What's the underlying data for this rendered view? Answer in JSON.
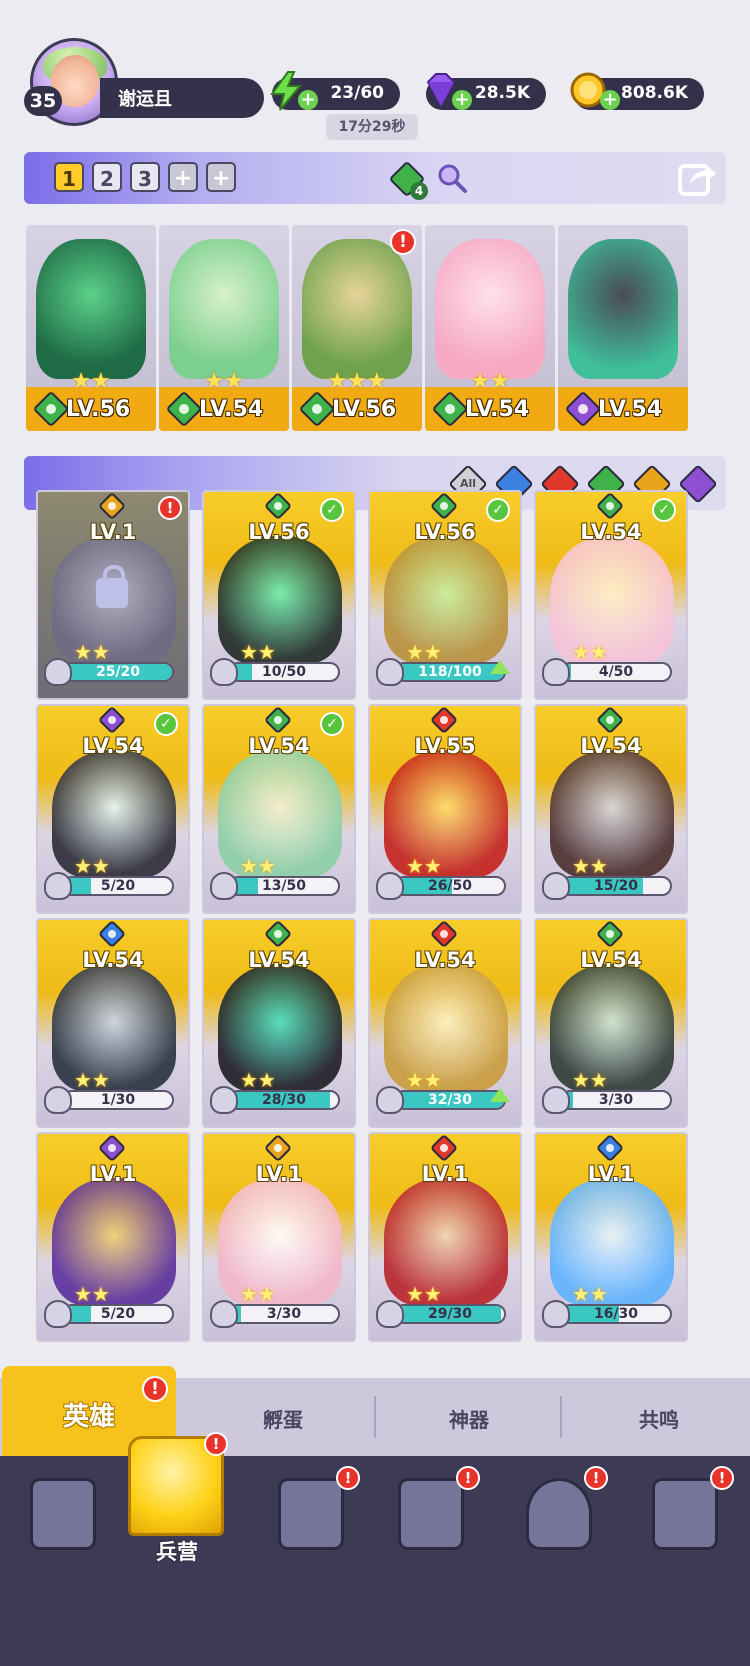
{
  "player": {
    "level": "35",
    "name": "谢运且"
  },
  "resources": {
    "energy": "23/60",
    "energy_timer": "17分29秒",
    "gems": "28.5K",
    "coins": "808.6K"
  },
  "formation": {
    "team_tabs": [
      "1",
      "2",
      "3",
      "+",
      "+"
    ],
    "active_team": "1",
    "artifact_count": "4",
    "cards": [
      {
        "stars": "★★",
        "level": "LV.56",
        "element": "nature",
        "alert": false
      },
      {
        "stars": "★★",
        "level": "LV.54",
        "element": "nature",
        "alert": false
      },
      {
        "stars": "★★★",
        "level": "LV.56",
        "element": "nature",
        "alert": true
      },
      {
        "stars": "★★",
        "level": "LV.54",
        "element": "nature",
        "alert": false
      },
      {
        "stars": "",
        "level": "LV.54",
        "element": "dark",
        "alert": false
      }
    ]
  },
  "filters": {
    "all_label": "All",
    "elements": [
      "water",
      "fire",
      "nature",
      "light",
      "dark"
    ]
  },
  "colors": {
    "nature": "#3fb34a",
    "dark": "#8e4fd3",
    "water": "#3b82e0",
    "fire": "#e0392b",
    "light": "#e8a51b"
  },
  "heroes": [
    {
      "level": "LV.1",
      "element": "light",
      "shards": "25/20",
      "progress": 1.0,
      "state": "locked"
    },
    {
      "level": "LV.56",
      "element": "nature",
      "shards": "10/50",
      "progress": 0.2,
      "state": "check"
    },
    {
      "level": "LV.56",
      "element": "nature",
      "shards": "118/100",
      "progress": 1.0,
      "state": "check"
    },
    {
      "level": "LV.54",
      "element": "nature",
      "shards": "4/50",
      "progress": 0.08,
      "state": "check"
    },
    {
      "level": "LV.54",
      "element": "dark",
      "shards": "5/20",
      "progress": 0.25,
      "state": "check"
    },
    {
      "level": "LV.54",
      "element": "nature",
      "shards": "13/50",
      "progress": 0.26,
      "state": "check"
    },
    {
      "level": "LV.55",
      "element": "fire",
      "shards": "26/50",
      "progress": 0.52,
      "state": "none"
    },
    {
      "level": "LV.54",
      "element": "nature",
      "shards": "15/20",
      "progress": 0.75,
      "state": "none"
    },
    {
      "level": "LV.54",
      "element": "water",
      "shards": "1/30",
      "progress": 0.03,
      "state": "none"
    },
    {
      "level": "LV.54",
      "element": "nature",
      "shards": "28/30",
      "progress": 0.93,
      "state": "none"
    },
    {
      "level": "LV.54",
      "element": "fire",
      "shards": "32/30",
      "progress": 1.0,
      "state": "none"
    },
    {
      "level": "LV.54",
      "element": "nature",
      "shards": "3/30",
      "progress": 0.1,
      "state": "none"
    },
    {
      "level": "LV.1",
      "element": "dark",
      "shards": "5/20",
      "progress": 0.25,
      "state": "none"
    },
    {
      "level": "LV.1",
      "element": "light",
      "shards": "3/30",
      "progress": 0.1,
      "state": "none"
    },
    {
      "level": "LV.1",
      "element": "fire",
      "shards": "29/30",
      "progress": 0.97,
      "state": "none"
    },
    {
      "level": "LV.1",
      "element": "water",
      "shards": "16/30",
      "progress": 0.53,
      "state": "none"
    }
  ],
  "subtabs": {
    "heroes": "英雄",
    "hatch": "孵蛋",
    "artifact": "神器",
    "resonance": "共鸣"
  },
  "nav": {
    "barracks": "兵营"
  }
}
